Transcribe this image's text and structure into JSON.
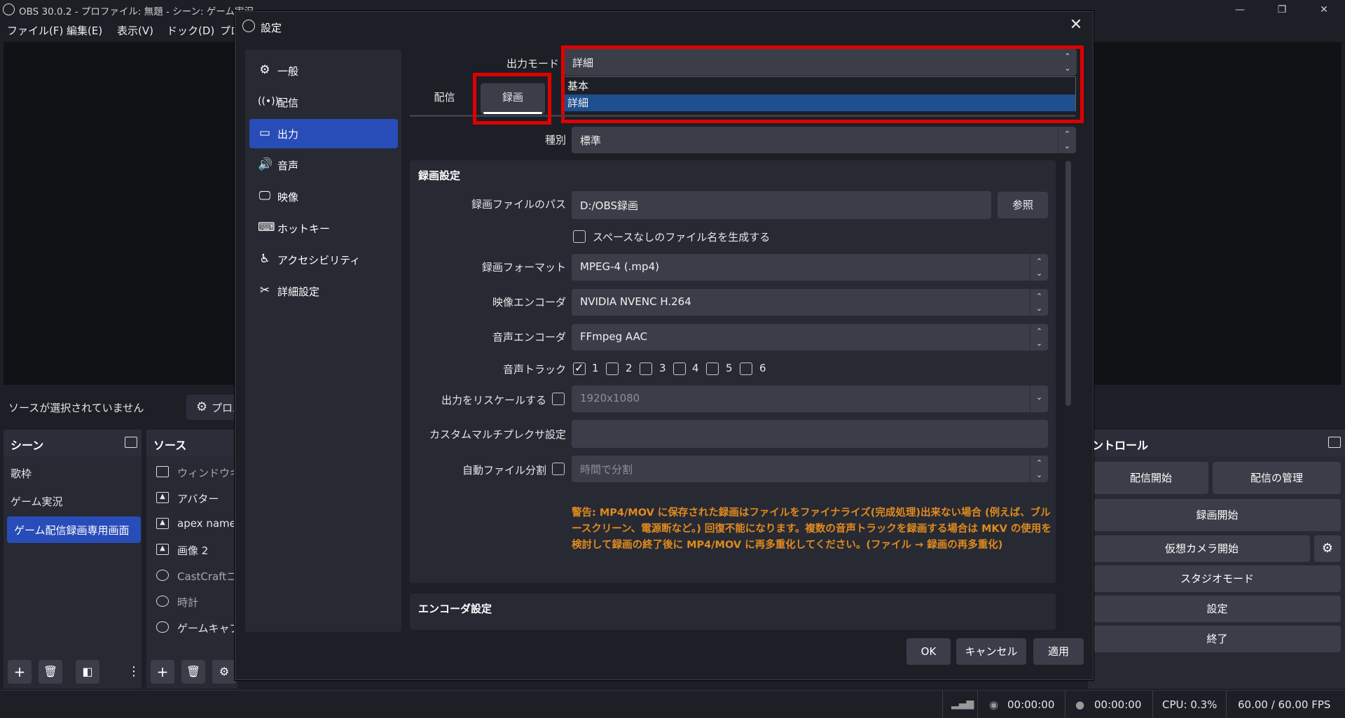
{
  "window": {
    "title": "OBS 30.0.2 - プロファイル: 無題 - シーン: ゲーム実況",
    "controls": {
      "minimize": "—",
      "maximize": "❐",
      "close": "✕"
    }
  },
  "menubar": [
    "ファイル(F)",
    "編集(E)",
    "表示(V)",
    "ドック(D)",
    "プロ"
  ],
  "context_bar": {
    "no_source": "ソースが選択されていません",
    "props_label": "プロパ"
  },
  "scenes": {
    "title": "シーン",
    "items": [
      "歌枠",
      "ゲーム実況",
      "ゲーム配信録画専用画面"
    ],
    "active_index": 2
  },
  "sources": {
    "title": "ソース",
    "items": [
      "ウィンドウキャ",
      "アバター",
      "apex name",
      "画像 2",
      "CastCraftコ",
      "時計",
      "ゲームキャプ"
    ]
  },
  "controls": {
    "title": "コントロール",
    "title_visible": "ントロール",
    "start_stream": "配信開始",
    "manage_stream": "配信の管理",
    "start_record": "録画開始",
    "start_vcam": "仮想カメラ開始",
    "studio_mode": "スタジオモード",
    "settings": "設定",
    "exit": "終了"
  },
  "statusbar": {
    "stream_time": "00:00:00",
    "record_time": "00:00:00",
    "cpu": "CPU: 0.3%",
    "fps": "60.00 / 60.00 FPS"
  },
  "settings": {
    "title": "設定",
    "close": "✕",
    "nav": [
      {
        "label": "一般",
        "icon": "gear-icon"
      },
      {
        "label": "配信",
        "icon": "broadcast-icon"
      },
      {
        "label": "出力",
        "icon": "output-icon",
        "active": true
      },
      {
        "label": "音声",
        "icon": "speaker-icon"
      },
      {
        "label": "映像",
        "icon": "monitor-icon"
      },
      {
        "label": "ホットキー",
        "icon": "keyboard-icon"
      },
      {
        "label": "アクセシビリティ",
        "icon": "accessibility-icon"
      },
      {
        "label": "詳細設定",
        "icon": "tools-icon"
      }
    ],
    "output_mode_label": "出力モード",
    "output_mode_value": "詳細",
    "output_mode_options": [
      "基本",
      "詳細"
    ],
    "output_mode_selected": "詳細",
    "tabs": [
      "配信",
      "録画"
    ],
    "active_tab": "録画",
    "type_label": "種別",
    "type_value": "標準",
    "recording_group": {
      "title": "録画設定",
      "path_label": "録画ファイルのパス",
      "path_value": "D:/OBS録画",
      "browse": "参照",
      "no_space_label": "スペースなしのファイル名を生成する",
      "no_space_checked": false,
      "format_label": "録画フォーマット",
      "format_value": "MPEG-4 (.mp4)",
      "video_encoder_label": "映像エンコーダ",
      "video_encoder_value": "NVIDIA NVENC H.264",
      "audio_encoder_label": "音声エンコーダ",
      "audio_encoder_value": "FFmpeg AAC",
      "audio_track_label": "音声トラック",
      "audio_tracks": [
        {
          "label": "1",
          "checked": true
        },
        {
          "label": "2",
          "checked": false
        },
        {
          "label": "3",
          "checked": false
        },
        {
          "label": "4",
          "checked": false
        },
        {
          "label": "5",
          "checked": false
        },
        {
          "label": "6",
          "checked": false
        }
      ],
      "rescale_label": "出力をリスケールする",
      "rescale_checked": false,
      "rescale_value": "1920x1080",
      "muxer_label": "カスタムマルチプレクサ設定",
      "muxer_value": "",
      "auto_split_label": "自動ファイル分割",
      "auto_split_checked": false,
      "auto_split_value": "時間で分割",
      "warning": "警告: MP4/MOV に保存された録画はファイルをファイナライズ(完成処理)出来ない場合 (例えば、ブルースクリーン、電源断など。) 回復不能になります。複数の音声トラックを録画する場合は MKV の使用を検討して録画の終了後に MP4/MOV に再多重化してください。(ファイル → 録画の再多重化)"
    },
    "encoder_group": {
      "title": "エンコーダ設定"
    },
    "buttons": {
      "ok": "OK",
      "cancel": "キャンセル",
      "apply": "適用"
    }
  },
  "colors": {
    "accent": "#284cb8",
    "highlight": "#e00000",
    "warning": "#e08a1e"
  }
}
